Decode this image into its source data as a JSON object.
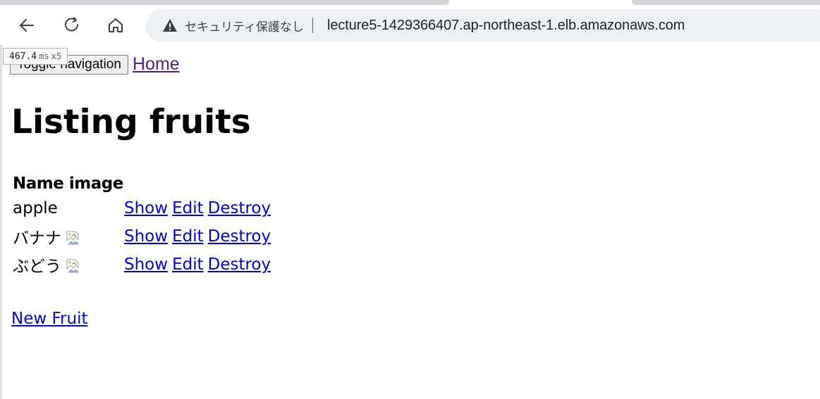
{
  "browser": {
    "security_text": "セキュリティ保護なし",
    "url": "lecture5-1429366407.ap-northeast-1.elb.amazonaws.com",
    "icons": [
      "back-arrow-icon",
      "reload-icon",
      "home-icon",
      "warning-icon"
    ]
  },
  "perf_badge": {
    "value": "467.4",
    "unit": "ms",
    "count": "x5"
  },
  "nav": {
    "toggle_label": "Toggle navigation",
    "home_label": "Home"
  },
  "page": {
    "title": "Listing fruits",
    "table": {
      "headers": {
        "name": "Name",
        "image": "image"
      },
      "rows": [
        {
          "name": "apple",
          "has_image": false
        },
        {
          "name": "バナナ",
          "has_image": true
        },
        {
          "name": "ぶどう",
          "has_image": true
        }
      ],
      "actions": {
        "show": "Show",
        "edit": "Edit",
        "destroy": "Destroy"
      }
    },
    "new_link": "New Fruit"
  },
  "colors": {
    "link": "#0000ee",
    "visited_link": "#551a8b",
    "omnibox_bg": "#eef1f4"
  }
}
